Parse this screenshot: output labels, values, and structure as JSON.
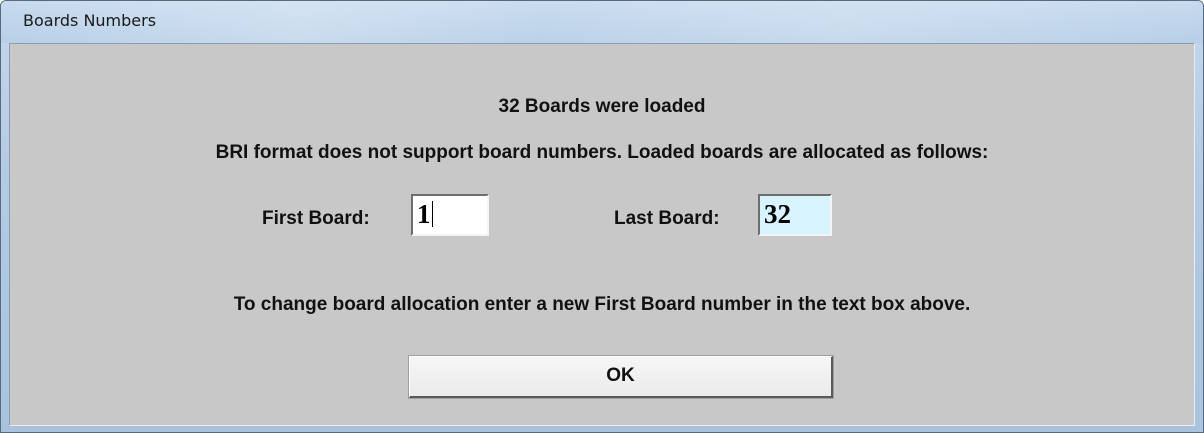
{
  "window": {
    "title": "Boards Numbers"
  },
  "dialog": {
    "loaded_message": "32 Boards were loaded",
    "format_message": "BRI format does not support board numbers. Loaded boards are allocated as follows:",
    "first_board_label": "First Board:",
    "first_board_value": "1",
    "last_board_label": "Last Board:",
    "last_board_value": "32",
    "instruction": "To change board allocation enter a new First Board number in the text box above.",
    "ok_label": "OK"
  },
  "colors": {
    "dialog_background": "#c8c8c8",
    "last_board_field_background": "#d8f4fe",
    "title_bar": "#b7cfe7"
  }
}
